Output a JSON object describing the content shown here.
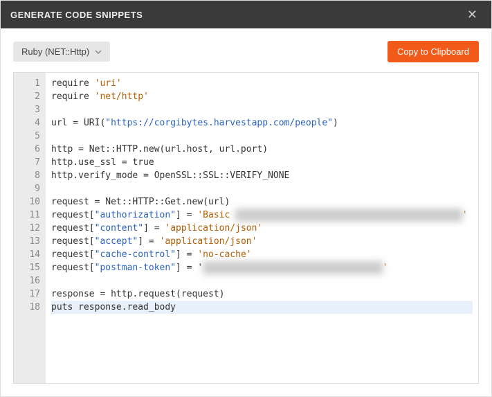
{
  "header": {
    "title": "GENERATE CODE SNIPPETS"
  },
  "toolbar": {
    "language_label": "Ruby (NET::Http)",
    "copy_label": "Copy to Clipboard"
  },
  "code": {
    "lines": [
      {
        "n": 1,
        "t": "require ",
        "str": "'uri'"
      },
      {
        "n": 2,
        "t": "require ",
        "str": "'net/http'"
      },
      {
        "n": 3,
        "t": ""
      },
      {
        "n": 4,
        "t": "url = URI(",
        "url": "\"https://corgibytes.harvestapp.com/people\"",
        "tail": ")"
      },
      {
        "n": 5,
        "t": ""
      },
      {
        "n": 6,
        "t": "http = Net::HTTP.new(url.host, url.port)"
      },
      {
        "n": 7,
        "t": "http.use_ssl = true"
      },
      {
        "n": 8,
        "t": "http.verify_mode = OpenSSL::SSL::VERIFY_NONE"
      },
      {
        "n": 9,
        "t": ""
      },
      {
        "n": 10,
        "t": "request = Net::HTTP::Get.new(url)"
      },
      {
        "n": 11,
        "t": "request[",
        "url": "\"authorization\"",
        "mid": "] = ",
        "str": "'Basic ",
        "blur": "████████████████████████████████████████████████",
        "tail": "'"
      },
      {
        "n": 12,
        "t": "request[",
        "url": "\"content\"",
        "mid": "] = ",
        "str": "'application/json'"
      },
      {
        "n": 13,
        "t": "request[",
        "url": "\"accept\"",
        "mid": "] = ",
        "str": "'application/json'"
      },
      {
        "n": 14,
        "t": "request[",
        "url": "\"cache-control\"",
        "mid": "] = ",
        "str": "'no-cache'"
      },
      {
        "n": 15,
        "t": "request[",
        "url": "\"postman-token\"",
        "mid": "] = '",
        "blur": "██████████████████████████████████████",
        "tail": "'"
      },
      {
        "n": 16,
        "t": ""
      },
      {
        "n": 17,
        "t": "response = http.request(request)"
      },
      {
        "n": 18,
        "t": "puts response.read_body",
        "hl": true
      }
    ]
  }
}
